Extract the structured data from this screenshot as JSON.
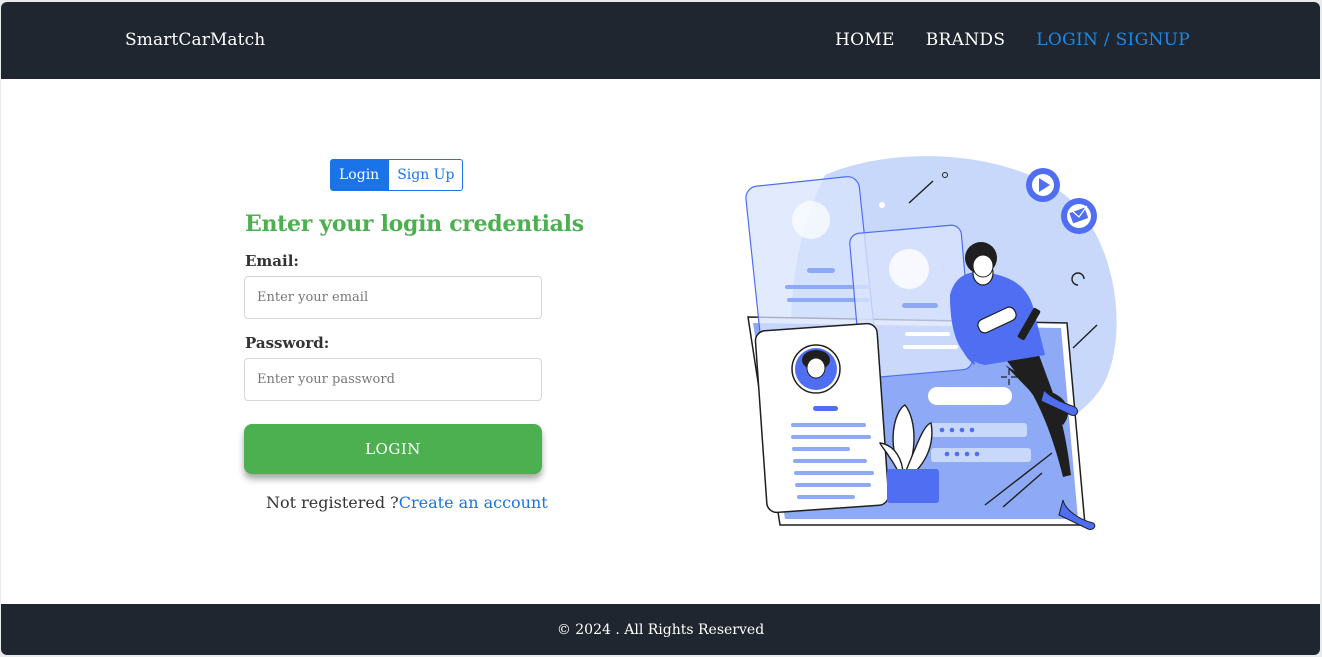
{
  "navbar": {
    "brand": "SmartCarMatch",
    "links": [
      "HOME",
      "BRANDS",
      "LOGIN / SIGNUP"
    ]
  },
  "auth": {
    "tabs": [
      "Login",
      "Sign Up"
    ],
    "heading": "Enter your login credentials",
    "email_label": "Email:",
    "email_placeholder": "Enter your email",
    "password_label": "Password:",
    "password_placeholder": "Enter your password",
    "login_button": "LOGIN",
    "register_prompt": "Not registered ?",
    "register_link": "Create an account"
  },
  "footer": {
    "text": "© 2024 . All Rights Reserved"
  },
  "colors": {
    "navbar_bg": "#1f262f",
    "accent_blue": "#1a73e8",
    "accent_green": "#4caf50",
    "illustration_blue": "#4f6ef2"
  }
}
